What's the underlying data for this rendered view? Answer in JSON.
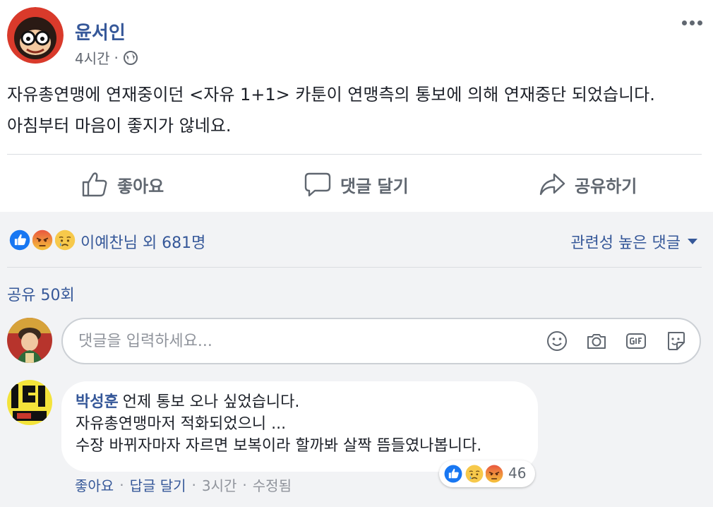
{
  "post": {
    "author": "윤서인",
    "time": "4시간",
    "separator": "·",
    "text_lines": [
      "자유총연맹에 연재중이던 <자유 1+1> 카툰이 연맹측의 통보에 의해 연재중단 되었습니다.",
      "아침부터 마음이 좋지가 않네요."
    ]
  },
  "actions": {
    "like": "좋아요",
    "comment": "댓글 달기",
    "share": "공유하기"
  },
  "reactions": {
    "summary": "이예찬님 외 681명",
    "icons": [
      "like-icon",
      "angry-icon",
      "sad-icon"
    ],
    "sort_label": "관련성 높은 댓글"
  },
  "shares": "공유 50회",
  "comment_input": {
    "placeholder": "댓글을 입력하세요..."
  },
  "comment": {
    "author": "박성훈",
    "lines": [
      "언제 통보 오나 싶었습니다.",
      "자유총연맹마저 적화되었으니 ...",
      "수장 바뀌자마자 자르면 보복이라 할까봐 살짝 뜸들였나봅니다."
    ],
    "reaction_count": "46",
    "reaction_icons": [
      "like-icon",
      "sad-icon",
      "angry-icon"
    ],
    "footer": {
      "like": "좋아요",
      "sep": "·",
      "reply": "답글 달기",
      "time": "3시간",
      "edited": "수정됨"
    }
  },
  "colors": {
    "link": "#365899",
    "muted": "#90949c",
    "background_comments": "#f2f3f5",
    "like_blue": "#1877f2"
  }
}
